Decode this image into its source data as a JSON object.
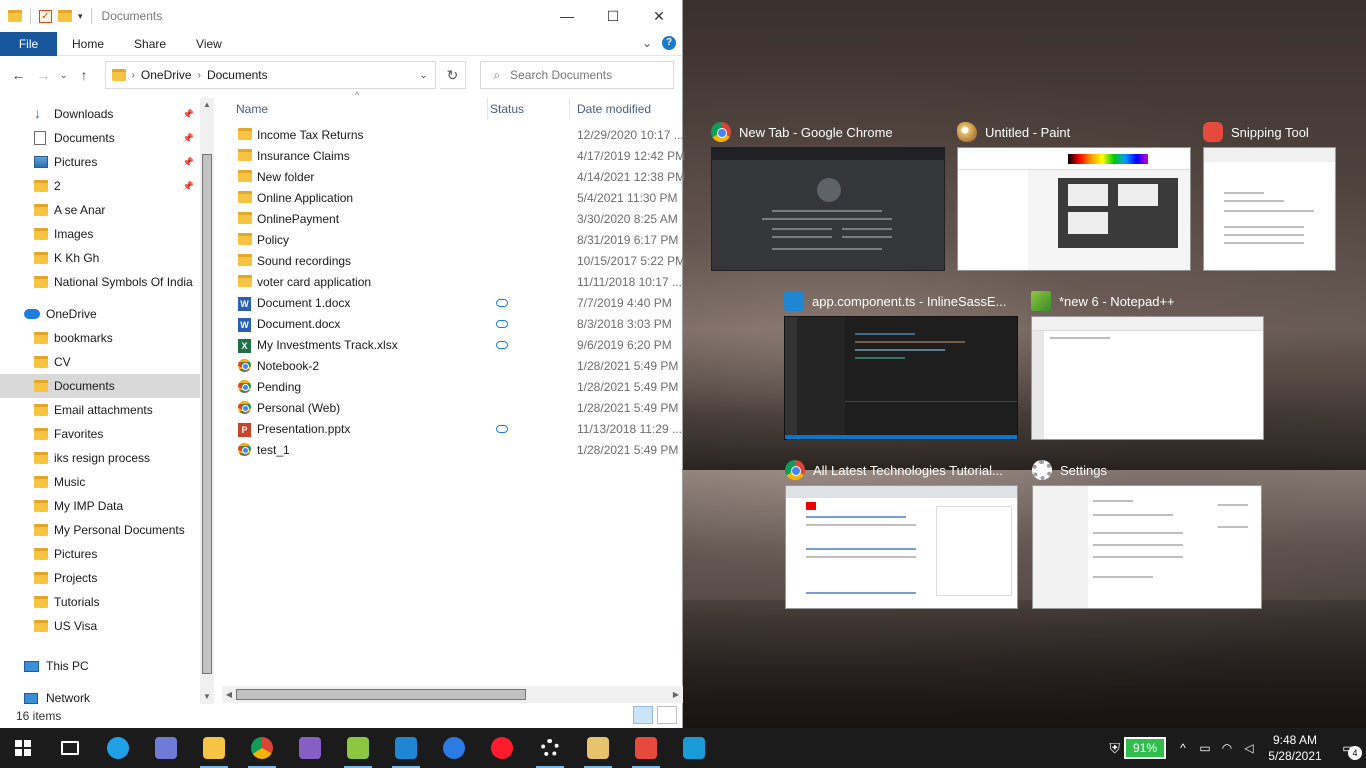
{
  "window": {
    "title": "Documents",
    "minimize": "—",
    "maximize": "☐",
    "close": "✕"
  },
  "ribbon": {
    "file": "File",
    "tabs": [
      "Home",
      "Share",
      "View"
    ],
    "expand": "⌄",
    "help": "?"
  },
  "address": {
    "path": [
      "OneDrive",
      "Documents"
    ],
    "search_placeholder": "Search Documents"
  },
  "nav": {
    "quick_access": [
      {
        "label": "Downloads",
        "icon": "download-icon",
        "pinned": true
      },
      {
        "label": "Documents",
        "icon": "document-icon",
        "pinned": true
      },
      {
        "label": "Pictures",
        "icon": "pictures-icon",
        "pinned": true
      },
      {
        "label": "2",
        "icon": "folder-icon",
        "pinned": true
      },
      {
        "label": "A se Anar",
        "icon": "folder-icon",
        "pinned": false
      },
      {
        "label": "Images",
        "icon": "folder-icon",
        "pinned": false
      },
      {
        "label": "K Kh Gh",
        "icon": "folder-icon",
        "pinned": false
      },
      {
        "label": "National Symbols Of India",
        "icon": "folder-icon",
        "pinned": false
      }
    ],
    "onedrive": "OneDrive",
    "onedrive_items": [
      "bookmarks",
      "CV",
      "Documents",
      "Email attachments",
      "Favorites",
      "iks resign process",
      "Music",
      "My IMP Data",
      "My Personal Documents",
      "Pictures",
      "Projects",
      "Tutorials",
      "US Visa"
    ],
    "selected": "Documents",
    "this_pc": "This PC",
    "network": "Network"
  },
  "columns": {
    "name": "Name",
    "status": "Status",
    "date": "Date modified"
  },
  "files": [
    {
      "name": "Income Tax Returns",
      "type": "folder",
      "status": "",
      "date": "12/29/2020 10:17 ..."
    },
    {
      "name": "Insurance Claims",
      "type": "folder",
      "status": "",
      "date": "4/17/2019 12:42 PM"
    },
    {
      "name": "New folder",
      "type": "folder",
      "status": "",
      "date": "4/14/2021 12:38 PM"
    },
    {
      "name": "Online Application",
      "type": "folder",
      "status": "",
      "date": "5/4/2021 11:30 PM"
    },
    {
      "name": "OnlinePayment",
      "type": "folder",
      "status": "",
      "date": "3/30/2020 8:25 AM"
    },
    {
      "name": "Policy",
      "type": "folder",
      "status": "",
      "date": "8/31/2019 6:17 PM"
    },
    {
      "name": "Sound recordings",
      "type": "folder",
      "status": "",
      "date": "10/15/2017 5:22 PM"
    },
    {
      "name": "voter card application",
      "type": "folder",
      "status": "",
      "date": "11/11/2018 10:17 ..."
    },
    {
      "name": "Document 1.docx",
      "type": "word",
      "status": "cloud",
      "date": "7/7/2019 4:40 PM"
    },
    {
      "name": "Document.docx",
      "type": "word",
      "status": "cloud",
      "date": "8/3/2018 3:03 PM"
    },
    {
      "name": "My Investments Track.xlsx",
      "type": "excel",
      "status": "cloud",
      "date": "9/6/2019 6:20 PM"
    },
    {
      "name": "Notebook-2",
      "type": "chrome",
      "status": "",
      "date": "1/28/2021 5:49 PM"
    },
    {
      "name": "Pending",
      "type": "chrome",
      "status": "",
      "date": "1/28/2021 5:49 PM"
    },
    {
      "name": "Personal (Web)",
      "type": "chrome",
      "status": "",
      "date": "1/28/2021 5:49 PM"
    },
    {
      "name": "Presentation.pptx",
      "type": "ppt",
      "status": "cloud",
      "date": "11/13/2018 11:29 ..."
    },
    {
      "name": "test_1",
      "type": "chrome",
      "status": "",
      "date": "1/28/2021 5:49 PM"
    }
  ],
  "status": {
    "count": "16 items"
  },
  "taskview": [
    {
      "title": "New Tab - Google Chrome",
      "icon": "chrome-icon"
    },
    {
      "title": "Untitled - Paint",
      "icon": "paint-icon"
    },
    {
      "title": "Snipping Tool",
      "icon": "snipping-tool-icon"
    },
    {
      "title": "app.component.ts - InlineSassE...",
      "icon": "vscode-icon"
    },
    {
      "title": "*new 6 - Notepad++",
      "icon": "notepad-plus-icon"
    },
    {
      "title": "All Latest Technologies Tutorial...",
      "icon": "chrome-icon"
    },
    {
      "title": "Settings",
      "icon": "settings-icon"
    }
  ],
  "taskbar": {
    "icons": [
      "task-view-icon",
      "edge-icon",
      "calculator-icon",
      "file-explorer-icon",
      "chrome-icon",
      "visual-studio-icon",
      "notepad-plus-icon",
      "vscode-icon",
      "maps-icon",
      "opera-icon",
      "settings-icon",
      "paint-icon",
      "snipping-tool-icon",
      "upload-icon"
    ],
    "battery": "91%",
    "time": "9:48 AM",
    "date": "5/28/2021",
    "notifications": "4"
  },
  "colors": {
    "accent": "#1979ca",
    "file_tab": "#19579d",
    "battery": "#2fbd4b",
    "taskbar": "#1b1b1b"
  }
}
